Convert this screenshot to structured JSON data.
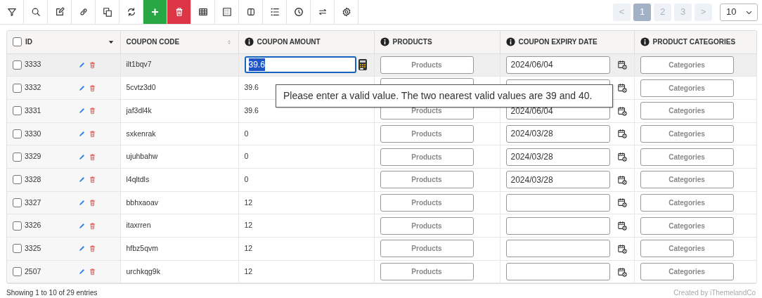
{
  "toolbar": [
    {
      "kind": "filter"
    },
    {
      "kind": "search"
    },
    {
      "kind": "edit"
    },
    {
      "kind": "link"
    },
    {
      "kind": "copy"
    },
    {
      "kind": "refresh"
    },
    {
      "kind": "add",
      "label": "+"
    },
    {
      "kind": "delete"
    },
    {
      "kind": "grid"
    },
    {
      "kind": "dotgrid"
    },
    {
      "kind": "columns"
    },
    {
      "kind": "list"
    },
    {
      "kind": "clock"
    },
    {
      "kind": "swap"
    },
    {
      "kind": "settings"
    }
  ],
  "pagination": {
    "pages": [
      {
        "label": "<",
        "selected": false
      },
      {
        "label": "1",
        "selected": true
      },
      {
        "label": "2",
        "selected": false
      },
      {
        "label": "3",
        "selected": false
      },
      {
        "label": ">",
        "selected": false
      }
    ],
    "per_page": "10"
  },
  "table": {
    "all_checked": false,
    "columns": [
      {
        "label": "ID",
        "info": false,
        "sorted": true,
        "sortable": true
      },
      {
        "label": "COUPON CODE",
        "info": false,
        "sorted": false,
        "sortable": true
      },
      {
        "label": "COUPON AMOUNT",
        "info": true
      },
      {
        "label": "PRODUCTS",
        "info": true
      },
      {
        "label": "COUPON EXPIRY DATE",
        "info": true
      },
      {
        "label": "PRODUCT CATEGORIES",
        "info": true
      }
    ],
    "rows": [
      {
        "id": "3333",
        "code": "ilt1bqv7",
        "amount": "39.6",
        "editing": true,
        "selected": true,
        "products": "Products",
        "expiry": "2024/06/04",
        "categories": "Categories"
      },
      {
        "id": "3332",
        "code": "5cvtz3d0",
        "amount": "39.6",
        "editing": false,
        "selected": false,
        "categories": "Categories"
      },
      {
        "id": "3331",
        "code": "jaf3dl4k",
        "amount": "39.6",
        "editing": false,
        "selected": false,
        "products": "Products",
        "expiry": "2024/06/04",
        "categories": "Categories"
      },
      {
        "id": "3330",
        "code": "sxkenrak",
        "amount": "0",
        "editing": false,
        "selected": false,
        "products": "Products",
        "expiry": "2024/03/28",
        "categories": "Categories"
      },
      {
        "id": "3329",
        "code": "ujuhbahw",
        "amount": "0",
        "editing": false,
        "selected": false,
        "products": "Products",
        "expiry": "2024/03/28",
        "categories": "Categories"
      },
      {
        "id": "3328",
        "code": "l4qltdls",
        "amount": "0",
        "editing": false,
        "selected": false,
        "products": "Products",
        "expiry": "2024/03/28",
        "categories": "Categories"
      },
      {
        "id": "3327",
        "code": "bbhxaoav",
        "amount": "12",
        "editing": false,
        "selected": false,
        "products": "Products",
        "categories": "Categories"
      },
      {
        "id": "3326",
        "code": "itaxrren",
        "amount": "12",
        "editing": false,
        "selected": false,
        "products": "Products",
        "categories": "Categories"
      },
      {
        "id": "3325",
        "code": "hfbz5qvm",
        "amount": "12",
        "editing": false,
        "selected": false,
        "products": "Products",
        "categories": "Categories"
      },
      {
        "id": "2507",
        "code": "urchkqg9k",
        "amount": "12",
        "editing": false,
        "selected": false,
        "products": "Products",
        "categories": "Categories"
      }
    ]
  },
  "tooltip": "Please enter a valid value. The two nearest valid values are 39 and 40.",
  "footer": {
    "info": "Showing 1 to 10 of 29 entries",
    "credit": "Created by iThemelandCo"
  }
}
